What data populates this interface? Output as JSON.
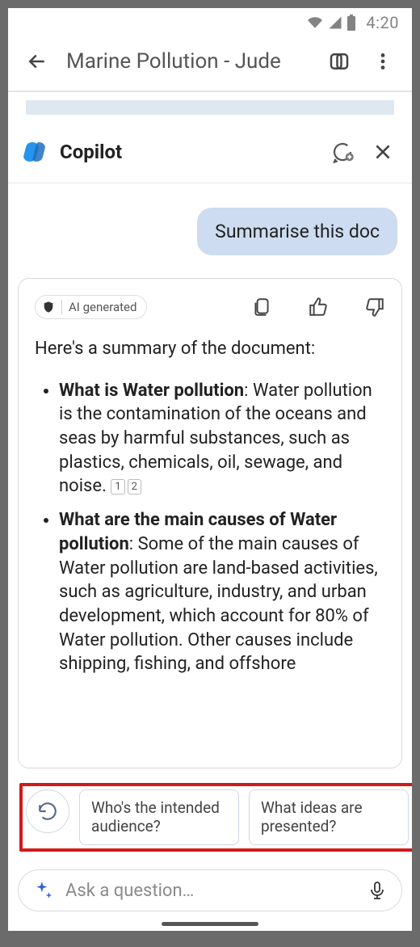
{
  "status": {
    "time": "4:20"
  },
  "nav": {
    "title": "Marine Pollution - Jude"
  },
  "copilot": {
    "title": "Copilot"
  },
  "user_message": "Summarise this doc",
  "ai_badge": "AI generated",
  "response": {
    "intro": "Here's a summary of the document:",
    "items": [
      {
        "title": "What is Water pollution",
        "body": ": Water pollution is the contamination of the oceans and seas by harmful substances, such as plastics, chemicals, oil, sewage, and noise.",
        "refs": [
          "1",
          "2"
        ]
      },
      {
        "title": "What are the main causes of Water pollution",
        "body": ": Some of the main causes of Water pollution are land-based activities, such as agriculture, industry, and urban development, which account for 80% of Water pollution. Other causes include shipping, fishing, and offshore",
        "refs": []
      }
    ]
  },
  "suggestions": [
    "Who's the intended audience?",
    "What ideas are presented?"
  ],
  "input": {
    "placeholder": "Ask a question…"
  }
}
